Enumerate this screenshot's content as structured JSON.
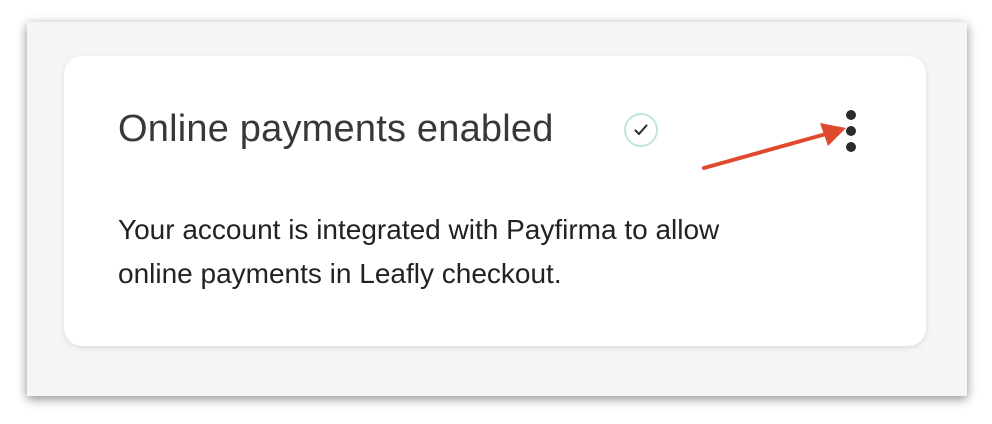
{
  "card": {
    "title": "Online payments enabled",
    "status_icon": "check-circle-icon",
    "menu_icon": "more-vertical-icon",
    "description_line1": "Your account is integrated with Payfirma to allow",
    "description_line2": "online payments in Leafly checkout."
  },
  "annotation": {
    "arrow_color": "#e04a2c"
  },
  "colors": {
    "check_border": "#bfe7d7",
    "title_text": "#383838",
    "body_text": "#222222"
  }
}
